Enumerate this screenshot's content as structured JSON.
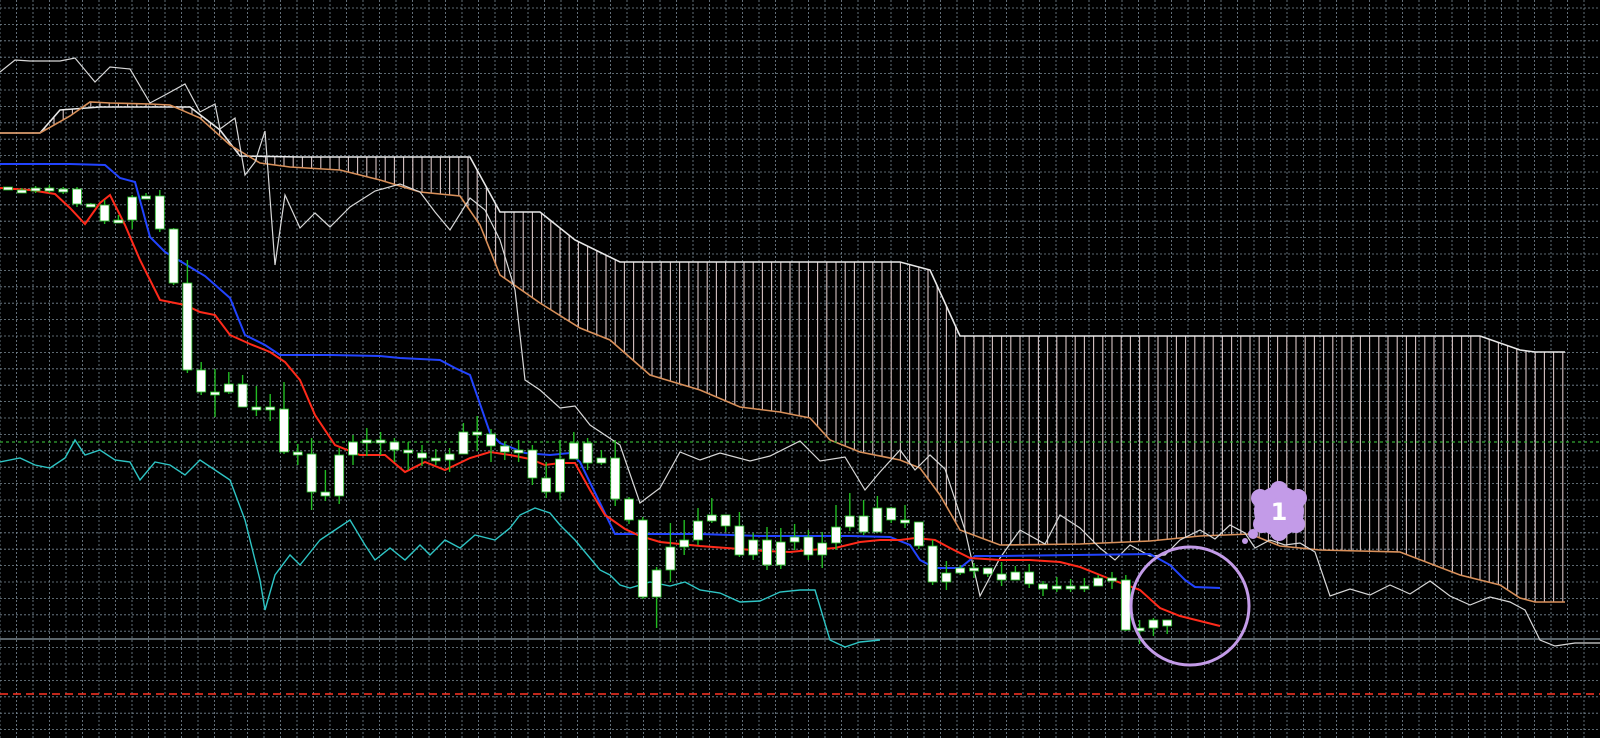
{
  "chart_data": {
    "type": "candlestick",
    "indicator": "ichimoku",
    "x": {
      "ticks": [],
      "labels": []
    },
    "y": {
      "ticks": [],
      "labels": []
    },
    "grid": "on",
    "colors": {
      "background": "#000000",
      "grid": "#7a8a96",
      "candle_body": "#ffffff",
      "candle_wick": "#22bb22",
      "tenkan_sen": "#ff2a1a",
      "kijun_sen": "#2244ff",
      "chikou_span": "#2ec4c4",
      "price_line": "#d8d8d8",
      "senkou_span_a": "#d9905a",
      "senkou_span_b": "#e8e8e8",
      "cloud_hatch": "#d8c4c4",
      "horizontal_green": "#33aa33",
      "horizontal_gray": "#8fa0aa",
      "horizontal_red": "#ff3322",
      "annotation": "#c39be8"
    },
    "annotation": {
      "label": "1",
      "marker": "circle-highlight"
    },
    "candles": [
      [
        1,
        187,
        188,
        190,
        187
      ],
      [
        2,
        190,
        191,
        193,
        188
      ],
      [
        3,
        190,
        188,
        193,
        186
      ],
      [
        4,
        188,
        191,
        193,
        185
      ],
      [
        5,
        191,
        189,
        194,
        187
      ],
      [
        6,
        189,
        204,
        207,
        187
      ],
      [
        7,
        204,
        205,
        207,
        203
      ],
      [
        8,
        205,
        221,
        224,
        200
      ],
      [
        9,
        221,
        220,
        223,
        215
      ],
      [
        10,
        220,
        197,
        229,
        195
      ],
      [
        11,
        197,
        196,
        199,
        193
      ],
      [
        12,
        196,
        229,
        232,
        190
      ],
      [
        13,
        229,
        283,
        285,
        228
      ],
      [
        14,
        283,
        370,
        373,
        260
      ],
      [
        15,
        370,
        392,
        395,
        362
      ],
      [
        16,
        392,
        392,
        417,
        369
      ],
      [
        17,
        392,
        384,
        394,
        372
      ],
      [
        18,
        384,
        407,
        407,
        375
      ],
      [
        19,
        407,
        407,
        416,
        386
      ],
      [
        20,
        407,
        409,
        421,
        394
      ],
      [
        21,
        409,
        452,
        454,
        382
      ],
      [
        22,
        452,
        454,
        465,
        444
      ],
      [
        23,
        454,
        492,
        510,
        438
      ],
      [
        24,
        492,
        496,
        501,
        470
      ],
      [
        25,
        496,
        455,
        504,
        448
      ],
      [
        26,
        455,
        442,
        465,
        435
      ],
      [
        27,
        442,
        440,
        456,
        428
      ],
      [
        28,
        440,
        442,
        455,
        432
      ],
      [
        29,
        442,
        450,
        462,
        438
      ],
      [
        30,
        450,
        453,
        470,
        442
      ],
      [
        31,
        453,
        458,
        466,
        445
      ],
      [
        32,
        458,
        460,
        465,
        449
      ],
      [
        33,
        460,
        454,
        472,
        448
      ],
      [
        34,
        454,
        432,
        450,
        423
      ],
      [
        35,
        432,
        434,
        451,
        416
      ],
      [
        36,
        434,
        446,
        462,
        429
      ],
      [
        37,
        446,
        452,
        460,
        442
      ],
      [
        38,
        452,
        450,
        462,
        440
      ],
      [
        39,
        450,
        478,
        485,
        445
      ],
      [
        40,
        478,
        492,
        498,
        462
      ],
      [
        41,
        492,
        459,
        500,
        440
      ],
      [
        42,
        459,
        443,
        455,
        432
      ],
      [
        43,
        443,
        463,
        470,
        438
      ],
      [
        44,
        463,
        458,
        465,
        450
      ],
      [
        45,
        458,
        499,
        506,
        440
      ],
      [
        46,
        499,
        520,
        524,
        497
      ],
      [
        47,
        520,
        597,
        599,
        517
      ],
      [
        48,
        597,
        570,
        628,
        567
      ],
      [
        49,
        570,
        547,
        582,
        523
      ],
      [
        50,
        547,
        540,
        555,
        520
      ],
      [
        51,
        540,
        521,
        545,
        508
      ],
      [
        52,
        521,
        515,
        523,
        498
      ],
      [
        53,
        515,
        526,
        532,
        518
      ],
      [
        54,
        526,
        555,
        557,
        512
      ],
      [
        55,
        555,
        540,
        560,
        533
      ],
      [
        56,
        540,
        565,
        570,
        527
      ],
      [
        57,
        565,
        542,
        569,
        528
      ],
      [
        58,
        542,
        537,
        550,
        524
      ],
      [
        59,
        537,
        555,
        560,
        530
      ],
      [
        60,
        555,
        543,
        568,
        532
      ],
      [
        61,
        543,
        527,
        550,
        505
      ],
      [
        62,
        527,
        516,
        531,
        493
      ],
      [
        63,
        516,
        532,
        535,
        500
      ],
      [
        64,
        532,
        508,
        532,
        496
      ],
      [
        65,
        508,
        520,
        523,
        507
      ],
      [
        66,
        520,
        522,
        528,
        505
      ],
      [
        67,
        522,
        546,
        549,
        522
      ],
      [
        68,
        546,
        582,
        585,
        540
      ],
      [
        69,
        582,
        573,
        590,
        561
      ],
      [
        70,
        573,
        568,
        575,
        565
      ],
      [
        71,
        568,
        568,
        578,
        563
      ],
      [
        72,
        568,
        574,
        577,
        570
      ],
      [
        73,
        574,
        580,
        586,
        562
      ],
      [
        74,
        580,
        572,
        577,
        566
      ],
      [
        75,
        572,
        584,
        588,
        564
      ],
      [
        76,
        584,
        589,
        596,
        581
      ],
      [
        77,
        589,
        586,
        592,
        577
      ],
      [
        78,
        586,
        588,
        592,
        579
      ],
      [
        79,
        588,
        586,
        592,
        578
      ],
      [
        80,
        586,
        578,
        582,
        575
      ],
      [
        81,
        578,
        580,
        589,
        572
      ],
      [
        82,
        580,
        630,
        631,
        575
      ],
      [
        83,
        630,
        628,
        644,
        620
      ],
      [
        84,
        628,
        620,
        636,
        618
      ],
      [
        85,
        620,
        626,
        634,
        620
      ]
    ]
  }
}
